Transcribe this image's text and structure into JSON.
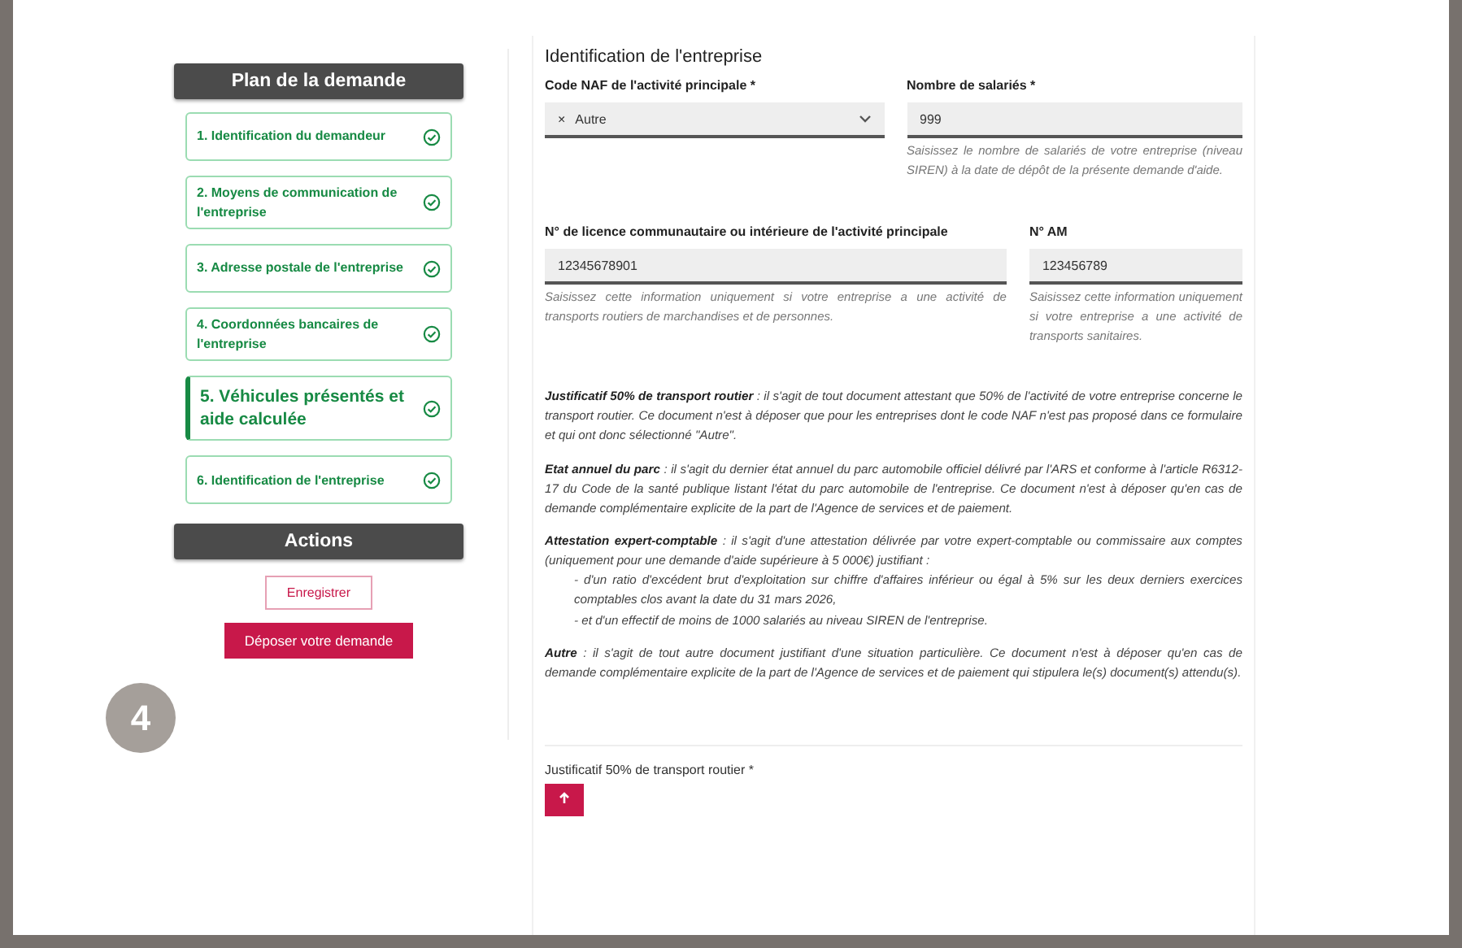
{
  "sidebar": {
    "plan_title": "Plan de la demande",
    "steps": [
      {
        "label": "1. Identification du demandeur",
        "selected": false,
        "completed": true
      },
      {
        "label": "2. Moyens de communication de l'entreprise",
        "selected": false,
        "completed": true
      },
      {
        "label": "3. Adresse postale de l'entreprise",
        "selected": false,
        "completed": true
      },
      {
        "label": "4. Coordonnées bancaires de l'entreprise",
        "selected": false,
        "completed": true
      },
      {
        "label": "5. Véhicules présentés et aide calculée",
        "selected": true,
        "completed": true
      },
      {
        "label": "6. Identification de l'entreprise",
        "selected": false,
        "completed": true
      }
    ],
    "actions_title": "Actions",
    "save_button": "Enregistrer",
    "submit_button": "Déposer votre demande"
  },
  "step_badge": "4",
  "form": {
    "title": "Identification de l'entreprise",
    "naf": {
      "label": "Code NAF de l'activité principale *",
      "chip_remove": "×",
      "value": "Autre"
    },
    "employees": {
      "label": "Nombre de salariés *",
      "value": "999",
      "hint": "Saisissez le nombre de salariés de votre entreprise (niveau SIREN) à la date de dépôt de la présente demande d'aide."
    },
    "licence": {
      "label": "N° de licence communautaire ou intérieure de l'activité principale",
      "value": "12345678901",
      "hint": "Saisissez cette information uniquement si votre entreprise a une activité de transports routiers de marchandises et de personnes."
    },
    "am": {
      "label": "N° AM",
      "value": "123456789",
      "hint": "Saisissez cette information uniquement si votre entreprise a une activité de transports sanitaires."
    },
    "notes": [
      {
        "text": "**Justificatif 50% de transport routier** : il s'agit de tout document attestant que 50% de l'activité de votre entreprise concerne le transport routier. Ce document n'est à déposer que pour les entreprises dont le code NAF n'est pas proposé dans ce formulaire et qui ont donc sélectionné \"Autre\"."
      },
      {
        "text": "**Etat annuel du parc** : il s'agit du dernier état annuel du parc automobile officiel délivré par l'ARS et conforme à l'article R6312-17 du Code de la santé publique listant l'état du parc automobile de l'entreprise. Ce document n'est à déposer qu'en cas de demande complémentaire explicite de la part de l'Agence de services et de paiement."
      },
      {
        "text": "**Attestation expert-comptable** : il s'agit d'une attestation délivrée par votre expert-comptable ou commissaire aux comptes (uniquement pour une demande d'aide supérieure à 5 000€) justifiant :",
        "lines": [
          "- d'un ratio d'excédent brut d'exploitation sur chiffre d'affaires inférieur ou égal à 5% sur les deux derniers exercices comptables clos avant la date du 31 mars 2026,",
          "- et d'un effectif de moins de 1000 salariés au niveau SIREN de l'entreprise."
        ]
      },
      {
        "text": "**Autre** : il s'agit de tout autre document justifiant d'une situation particulière. Ce document n'est à déposer qu'en cas de demande complémentaire explicite de la part de l'Agence de services et de paiement qui stipulera le(s) document(s) attendu(s)."
      }
    ],
    "upload_label": "Justificatif 50% de transport routier *"
  }
}
